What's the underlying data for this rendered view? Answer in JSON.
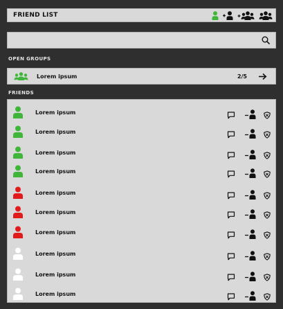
{
  "header": {
    "title": "FRIEND LIST",
    "icons": [
      "user-green-icon",
      "add-friend-icon",
      "add-group-icon",
      "group-icon"
    ]
  },
  "search": {
    "value": "",
    "icon": "search-icon"
  },
  "open_groups": {
    "label": "OPEN GROUPS",
    "items": [
      {
        "name": "Lorem ipsum",
        "count": "2/5",
        "icon": "group-green-icon",
        "action_icon": "arrow-right-icon"
      }
    ]
  },
  "friends": {
    "label": "FRIENDS",
    "items": [
      {
        "name": "Lorem ipsum",
        "status": "online"
      },
      {
        "name": "Lorem ipsum",
        "status": "online"
      },
      {
        "name": "Lorem ipsum",
        "status": "online"
      },
      {
        "name": "Lorem ipsum",
        "status": "online"
      },
      {
        "name": "Lorem ipsum",
        "status": "busy"
      },
      {
        "name": "Lorem ipsum",
        "status": "busy"
      },
      {
        "name": "Lorem ipsum",
        "status": "busy"
      },
      {
        "name": "Lorem ipsum",
        "status": "offline"
      },
      {
        "name": "Lorem ipsum",
        "status": "offline"
      },
      {
        "name": "Lorem ipsum",
        "status": "offline"
      }
    ],
    "row_actions": [
      "chat-icon",
      "remove-friend-icon",
      "block-icon"
    ]
  },
  "colors": {
    "online": "#3fb53a",
    "busy": "#e11b1b",
    "offline": "#ffffff"
  }
}
